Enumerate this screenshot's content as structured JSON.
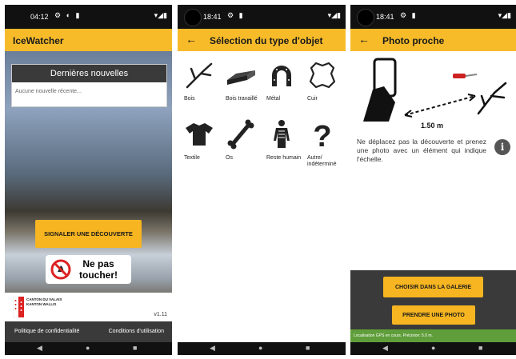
{
  "screen1": {
    "status_time": "04:12",
    "app_title": "IceWatcher",
    "news_heading": "Dernières nouvelles",
    "news_empty": "Aucune nouvelle récente...",
    "report_button": "SIGNALER UNE DÉCOUVERTE",
    "dont_touch_line1": "Ne pas",
    "dont_touch_line2": "toucher!",
    "canton_line1": "CANTON DU VALAIS",
    "canton_line2": "KANTON WALLIS",
    "version": "v1.11",
    "privacy_link": "Politique de confidentialité",
    "terms_link": "Conditions d'utilisation"
  },
  "screen2": {
    "status_time": "18:41",
    "title": "Sélection du type d'objet",
    "objects": [
      {
        "label": "Bois",
        "icon": "wood-branch-icon"
      },
      {
        "label": "Bois travaillé",
        "icon": "worked-wood-plank-icon"
      },
      {
        "label": "Métal",
        "icon": "horseshoe-icon"
      },
      {
        "label": "Cuir",
        "icon": "leather-hide-icon"
      },
      {
        "label": "Textile",
        "icon": "tshirt-icon"
      },
      {
        "label": "Os",
        "icon": "bone-icon"
      },
      {
        "label": "Reste humain",
        "icon": "human-skeleton-icon"
      },
      {
        "label": "Autre/ indéterminé",
        "icon": "question-mark-icon"
      }
    ]
  },
  "screen3": {
    "status_time": "18:41",
    "title": "Photo proche",
    "distance": "1.50 m",
    "instruction": "Ne déplacez pas la découverte et prenez une photo avec un élément qui indique l'échelle.",
    "gallery_button": "CHOISIR DANS LA GALERIE",
    "photo_button": "PRENDRE UNE PHOTO",
    "gps_status": "Localisation GPS en cours. Précision: 5.0 m."
  },
  "colors": {
    "accent": "#f7bb2a",
    "button": "#f6b521",
    "gps_bar": "#5f9e3a",
    "dark_panel": "#3a3a3a"
  }
}
